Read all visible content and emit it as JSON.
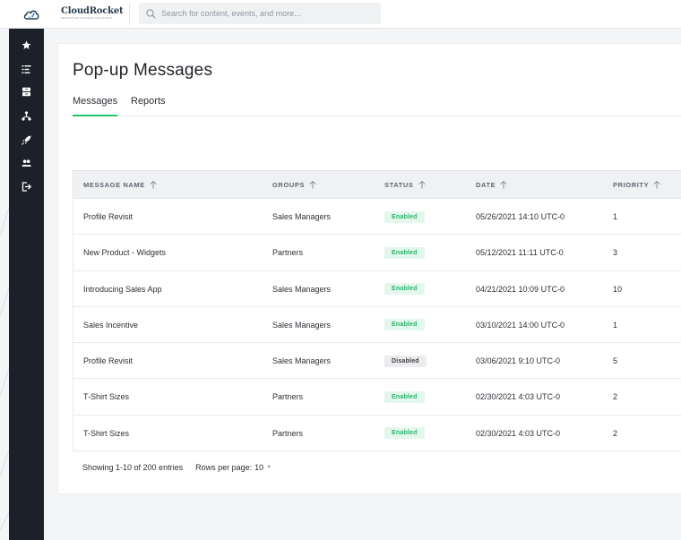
{
  "app": {
    "brand_name": "CloudRocket",
    "brand_tagline": "INNOVATIVE STORAGE SOLUTIONS",
    "colors": {
      "accent": "#27c26c",
      "sidebar": "#1c2129",
      "logo": "#2a3b4d"
    }
  },
  "search": {
    "placeholder": "Search for content, events, and more..."
  },
  "sidebar": {
    "items": [
      {
        "icon": "star-icon"
      },
      {
        "icon": "list-icon"
      },
      {
        "icon": "archive-icon"
      },
      {
        "icon": "hierarchy-icon"
      },
      {
        "icon": "rocket-icon"
      },
      {
        "icon": "users-icon"
      },
      {
        "icon": "logout-icon"
      }
    ]
  },
  "page": {
    "title": "Pop-up Messages",
    "tabs": [
      {
        "label": "Messages",
        "active": true
      },
      {
        "label": "Reports",
        "active": false
      }
    ]
  },
  "table": {
    "columns": [
      "MESSAGE NAME",
      "GROUPS",
      "STATUS",
      "DATE",
      "PRIORITY"
    ],
    "rows": [
      {
        "name": "Profile Revisit",
        "group": "Sales Managers",
        "status": "Enabled",
        "date": "05/26/2021 14:10 UTC-0",
        "priority": "1"
      },
      {
        "name": "New Product - Widgets",
        "group": "Partners",
        "status": "Enabled",
        "date": "05/12/2021 11:11 UTC-0",
        "priority": "3"
      },
      {
        "name": "Introducing Sales App",
        "group": "Sales Managers",
        "status": "Enabled",
        "date": "04/21/2021 10:09 UTC-0",
        "priority": "10"
      },
      {
        "name": "Sales Incentive",
        "group": "Sales Managers",
        "status": "Enabled",
        "date": "03/10/2021 14:00 UTC-0",
        "priority": "1"
      },
      {
        "name": "Profile Revisit",
        "group": "Sales Managers",
        "status": "Disabled",
        "date": "03/06/2021 9:10 UTC-0",
        "priority": "5"
      },
      {
        "name": "T-Shirt Sizes",
        "group": "Partners",
        "status": "Enabled",
        "date": "02/30/2021 4:03 UTC-0",
        "priority": "2"
      },
      {
        "name": "T-Shirt Sizes",
        "group": "Partners",
        "status": "Enabled",
        "date": "02/30/2021 4:03 UTC-0",
        "priority": "2"
      }
    ]
  },
  "pagination": {
    "showing": "Showing 1-10 of 200 entries",
    "rows_per_page_label": "Rows per page:",
    "rows_per_page_value": "10"
  }
}
